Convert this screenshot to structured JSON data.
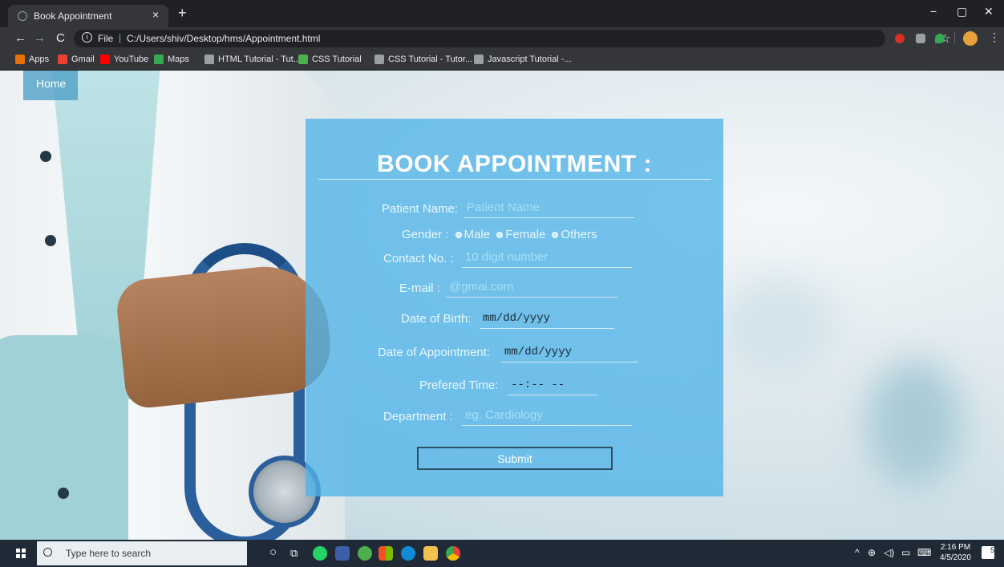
{
  "browser": {
    "tab_title": "Book Appointment",
    "tab_close": "×",
    "new_tab": "+",
    "nav": {
      "back": "←",
      "forward": "→",
      "reload": "C"
    },
    "omnibox": {
      "scheme_label": "File",
      "separator": "|",
      "url": "C:/Users/shiv/Desktop/hms/Appointment.html"
    },
    "bookmarks": [
      {
        "label": "Apps",
        "icon": "apps-grid-icon",
        "color": "#e8710a"
      },
      {
        "label": "Gmail",
        "icon": "gmail-icon",
        "color": "#ea4335"
      },
      {
        "label": "YouTube",
        "icon": "youtube-icon",
        "color": "#ff0000"
      },
      {
        "label": "Maps",
        "icon": "maps-icon",
        "color": "#34a853"
      },
      {
        "label": "HTML Tutorial - Tut...",
        "icon": "w3schools-icon",
        "color": "#9aa0a6"
      },
      {
        "label": "CSS Tutorial",
        "icon": "w3schools-icon",
        "color": "#4caf50"
      },
      {
        "label": "CSS Tutorial - Tutor...",
        "icon": "w3schools-icon",
        "color": "#9aa0a6"
      },
      {
        "label": "Javascript Tutorial -...",
        "icon": "w3schools-icon",
        "color": "#9aa0a6"
      }
    ],
    "window_controls": {
      "minimize": "−",
      "maximize": "▢",
      "close": "✕"
    },
    "star": "☆",
    "menu": "⋮"
  },
  "page": {
    "nav_home": "Home",
    "form": {
      "title": "BOOK APPOINTMENT :",
      "patient_name": {
        "label": "Patient Name:",
        "placeholder": "Patient Name"
      },
      "gender": {
        "label": "Gender :",
        "options": [
          "Male",
          "Female",
          "Others"
        ]
      },
      "contact": {
        "label": "Contact No. :",
        "placeholder": "10 digit number"
      },
      "email": {
        "label": "E-mail :",
        "placeholder": "@gmai.com"
      },
      "dob": {
        "label": "Date of Birth:",
        "value": "mm/dd/yyyy"
      },
      "doa": {
        "label": "Date of Appointment:",
        "value": "mm/dd/yyyy"
      },
      "time": {
        "label": "Prefered Time:",
        "value": "--:-- --"
      },
      "department": {
        "label": "Department :",
        "placeholder": "eg. Cardiology"
      },
      "submit": "Submit"
    },
    "colors": {
      "panel": "#50b4e8",
      "home_bg": "#4fa0c4",
      "accent_text": "#ffffff"
    }
  },
  "taskbar": {
    "search_text": "Type here to search",
    "clock_time": "2:16 PM",
    "clock_date": "4/5/2020",
    "notification_count": "5",
    "tray_chevron": "^"
  }
}
